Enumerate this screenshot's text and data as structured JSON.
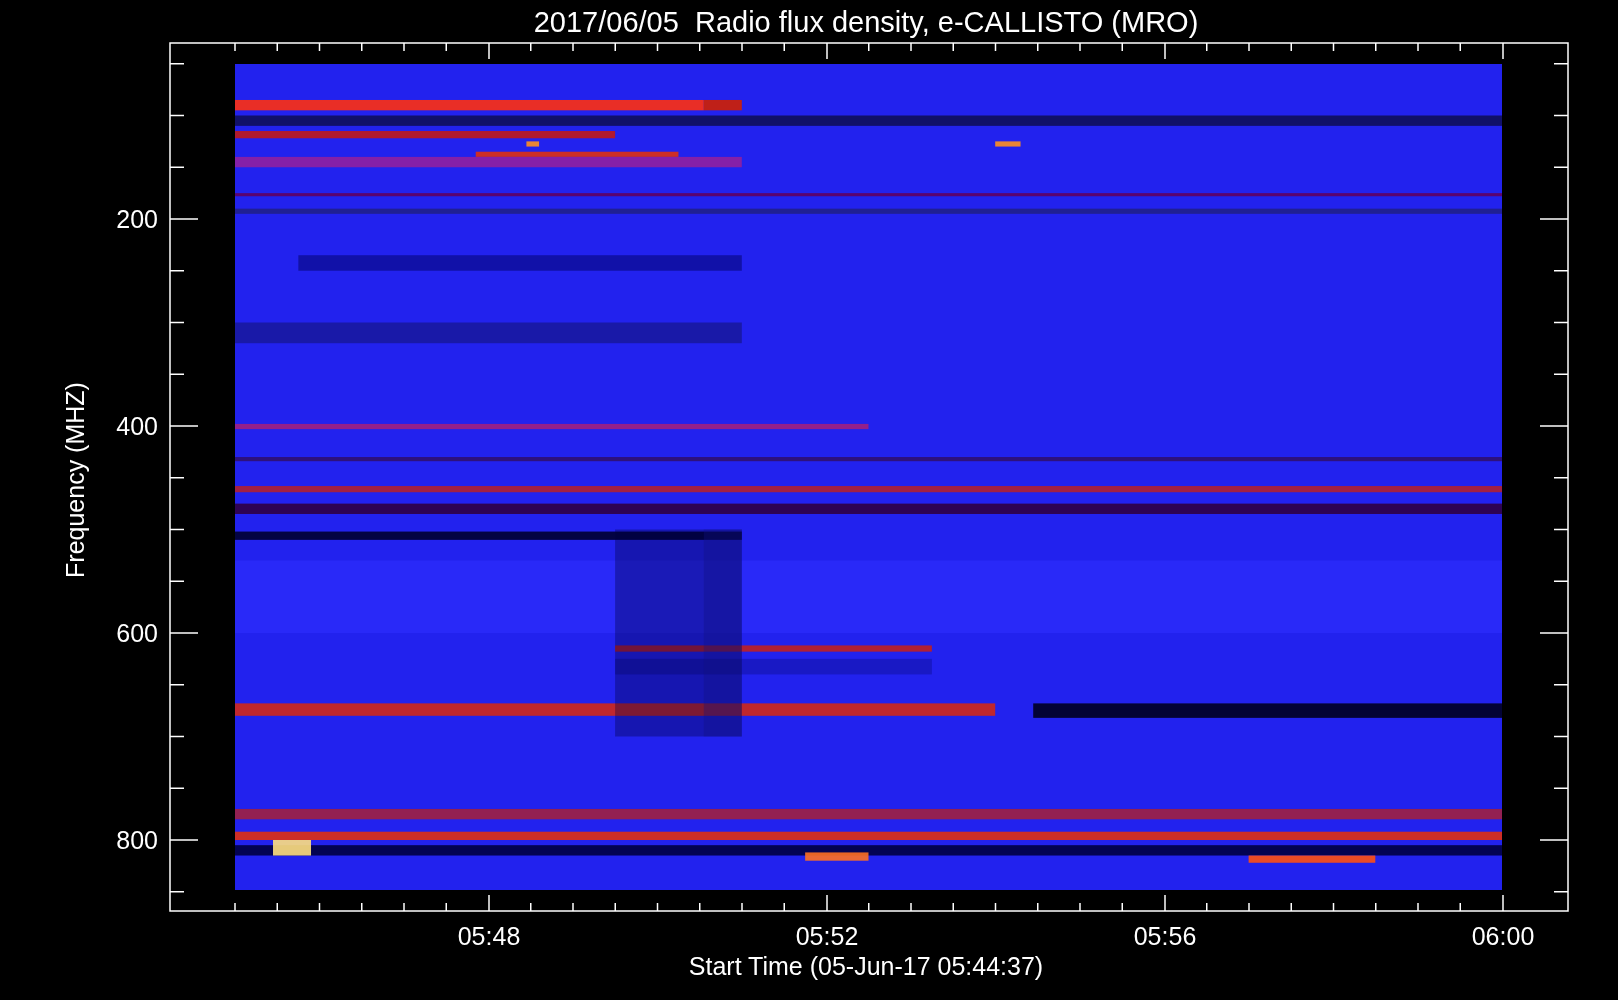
{
  "title": "2017/06/05  Radio flux density, e-CALLISTO (MRO)",
  "y_axis": {
    "label": "Frequency (MHZ)",
    "ticks": [
      "200",
      "400",
      "600",
      "800"
    ]
  },
  "x_axis": {
    "label": "Start Time (05-Jun-17 05:44:37)",
    "ticks": [
      "05:48",
      "05:52",
      "05:56",
      "06:00"
    ]
  }
}
